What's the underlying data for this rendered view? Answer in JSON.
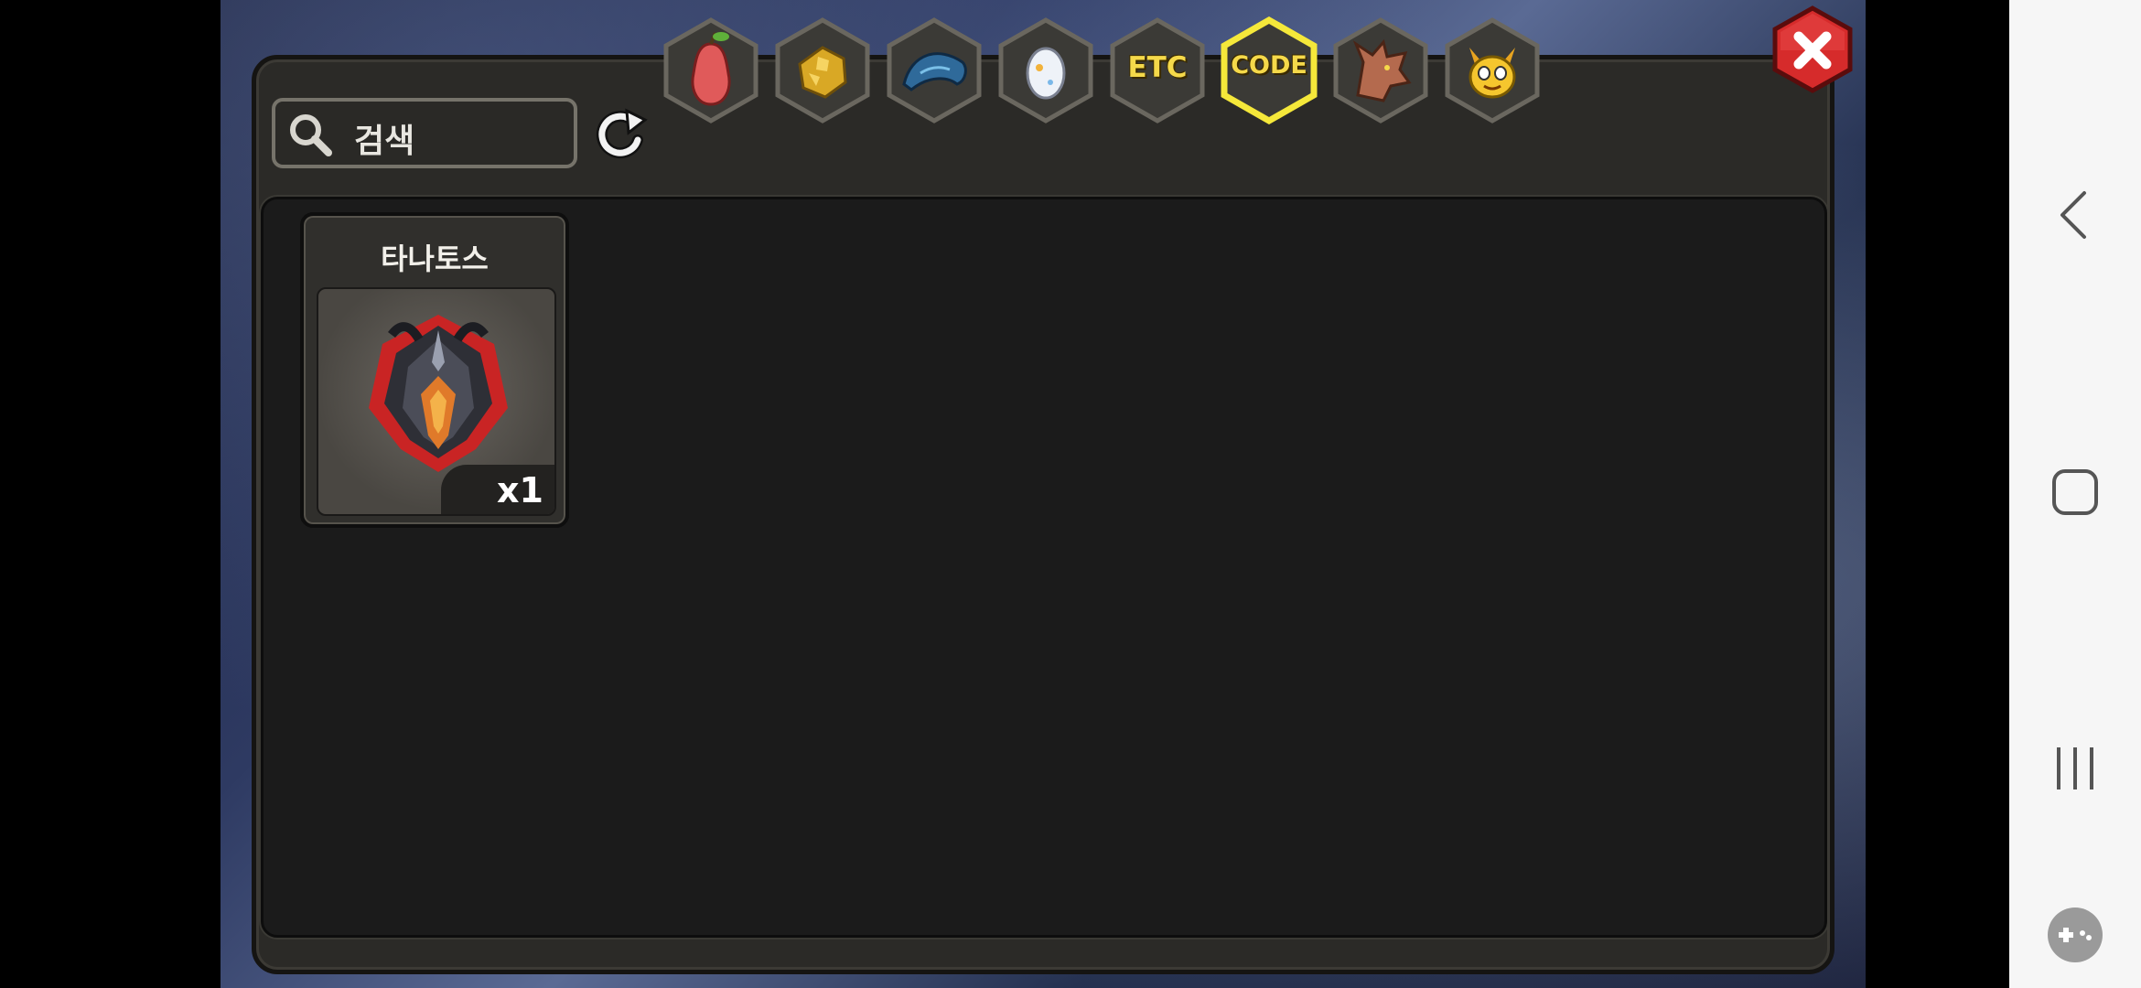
{
  "search": {
    "placeholder": "검색",
    "icon": "search-icon"
  },
  "refresh": {
    "icon": "refresh-icon"
  },
  "tabs": [
    {
      "id": "tab-fruit",
      "icon": "pear-icon",
      "label": ""
    },
    {
      "id": "tab-ore",
      "icon": "gold-ore-icon",
      "label": ""
    },
    {
      "id": "tab-scale",
      "icon": "blue-scale-icon",
      "label": ""
    },
    {
      "id": "tab-egg",
      "icon": "egg-icon",
      "label": ""
    },
    {
      "id": "tab-etc",
      "icon": "",
      "label": "ETC"
    },
    {
      "id": "tab-code",
      "icon": "",
      "label": "CODE",
      "selected": true
    },
    {
      "id": "tab-dragon",
      "icon": "dragon-head-icon",
      "label": ""
    },
    {
      "id": "tab-monster",
      "icon": "yellow-monster-icon",
      "label": ""
    }
  ],
  "items": [
    {
      "name": "타나토스",
      "quantity": "x1",
      "icon": "thanatos-emblem-icon"
    }
  ],
  "close": {
    "icon": "close-icon"
  },
  "system_nav": {
    "back": "back-icon",
    "home": "home-icon",
    "recents": "recents-icon",
    "game": "gamepad-icon"
  },
  "colors": {
    "accent_yellow": "#f5d94a",
    "close_red": "#d62b2b",
    "panel": "#2b2a27",
    "inner": "#1b1b1b"
  }
}
